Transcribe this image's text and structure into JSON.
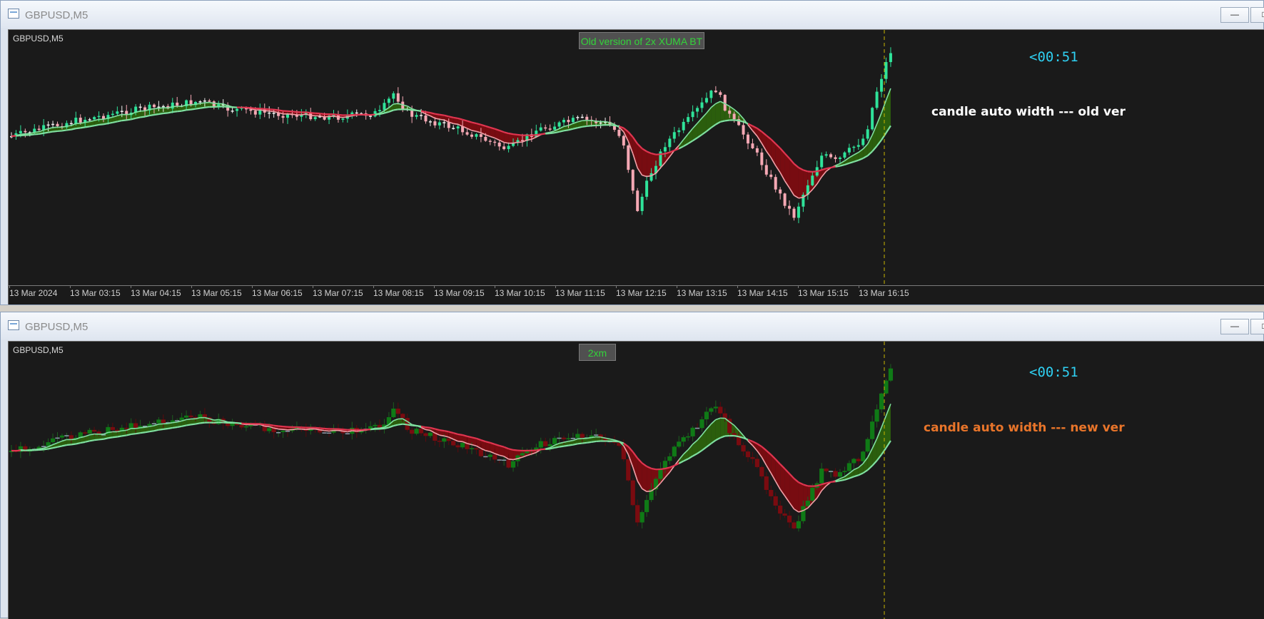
{
  "windows": [
    {
      "title": "GBPUSD,M5",
      "symbol_label": "GBPUSD,M5",
      "indicator_label": "Old version of 2x XUMA BT",
      "countdown": "<00:51",
      "note": "candle auto width --- old ver",
      "note_color": "#ffffff",
      "time_axis": [
        "13 Mar 2024",
        "13 Mar 03:15",
        "13 Mar 04:15",
        "13 Mar 05:15",
        "13 Mar 06:15",
        "13 Mar 07:15",
        "13 Mar 08:15",
        "13 Mar 09:15",
        "13 Mar 10:15",
        "13 Mar 11:15",
        "13 Mar 12:15",
        "13 Mar 13:15",
        "13 Mar 14:15",
        "13 Mar 15:15",
        "13 Mar 16:15"
      ],
      "candle_style": "old",
      "colors": {
        "bull": "#2fe39a",
        "bear": "#f5a8b4",
        "neutral": "#f0f0f0"
      }
    },
    {
      "title": "GBPUSD,M5",
      "symbol_label": "GBPUSD,M5",
      "indicator_label": "2xm",
      "countdown": "<00:51",
      "note": "candle auto width --- new ver",
      "note_color": "#e9752a",
      "time_axis": [],
      "candle_style": "new",
      "colors": {
        "bull": "#0f7a16",
        "bear": "#7a0b10",
        "neutral": "#8fa0b0"
      }
    }
  ],
  "window_buttons": {
    "minimize": "—",
    "maximize": "□"
  },
  "chart_colors": {
    "background": "#1a1a1a",
    "fast_ma": "#f2a0a8",
    "slow_ma": "#6ee08a",
    "up_fill": "#2f6b0c",
    "down_fill": "#8a0a10",
    "bear_line": "#e03550",
    "bull_line": "#7fe0a0",
    "now_line": "#c8b400"
  }
}
